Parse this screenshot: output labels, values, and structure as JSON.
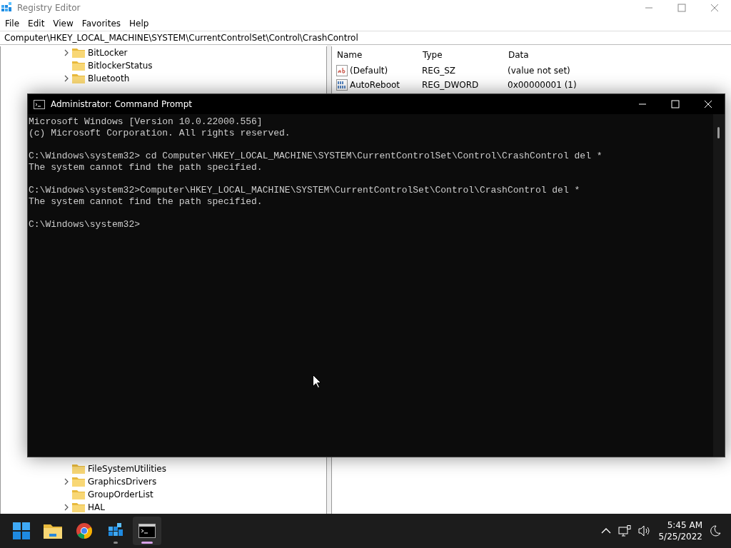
{
  "registry_editor": {
    "title": "Registry Editor",
    "menu": [
      "File",
      "Edit",
      "View",
      "Favorites",
      "Help"
    ],
    "address": "Computer\\HKEY_LOCAL_MACHINE\\SYSTEM\\CurrentControlSet\\Control\\CrashControl",
    "tree_top": [
      {
        "label": "BitLocker",
        "has_children": true
      },
      {
        "label": "BitlockerStatus",
        "has_children": false
      },
      {
        "label": "Bluetooth",
        "has_children": true
      }
    ],
    "tree_bottom": [
      {
        "label": "FileSystemUtilities",
        "has_children": false
      },
      {
        "label": "GraphicsDrivers",
        "has_children": true
      },
      {
        "label": "GroupOrderList",
        "has_children": false
      },
      {
        "label": "HAL",
        "has_children": true
      }
    ],
    "columns": [
      "Name",
      "Type",
      "Data"
    ],
    "values": [
      {
        "kind": "string",
        "name": "(Default)",
        "type": "REG_SZ",
        "data": "(value not set)"
      },
      {
        "kind": "binary",
        "name": "AutoReboot",
        "type": "REG_DWORD",
        "data": "0x00000001 (1)"
      }
    ]
  },
  "console": {
    "title": "Administrator: Command Prompt",
    "blocks": [
      [
        "Microsoft Windows [Version 10.0.22000.556]",
        "(c) Microsoft Corporation. All rights reserved."
      ],
      [
        "C:\\Windows\\system32> cd Computer\\HKEY_LOCAL_MACHINE\\SYSTEM\\CurrentControlSet\\Control\\CrashControl del *",
        "The system cannot find the path specified."
      ],
      [
        "C:\\Windows\\system32>Computer\\HKEY_LOCAL_MACHINE\\SYSTEM\\CurrentControlSet\\Control\\CrashControl del *",
        "The system cannot find the path specified."
      ],
      [
        "C:\\Windows\\system32>"
      ]
    ]
  },
  "taskbar": {
    "apps": [
      {
        "kind": "start",
        "running": false,
        "active": false
      },
      {
        "kind": "folder",
        "running": false,
        "active": false
      },
      {
        "kind": "browser",
        "running": false,
        "active": false
      },
      {
        "kind": "registry",
        "running": true,
        "active": false
      },
      {
        "kind": "console",
        "running": true,
        "active": true
      }
    ],
    "time": "5:45 AM",
    "date": "5/25/2022"
  }
}
